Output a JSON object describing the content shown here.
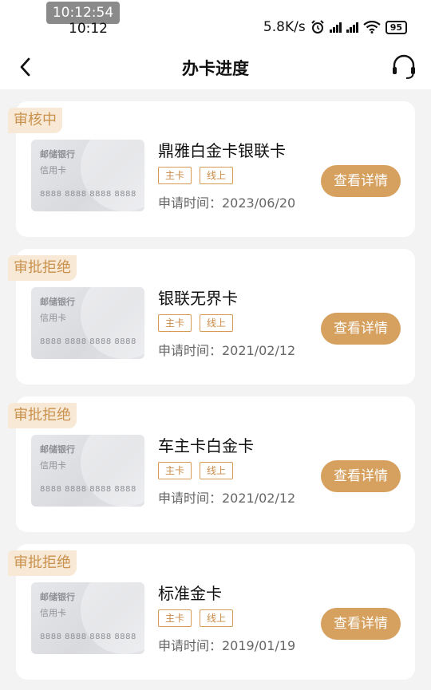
{
  "status_bar": {
    "time_overlay": "10:12:54",
    "time": "10:12",
    "net_speed": "5.8K/s",
    "battery": "95"
  },
  "header": {
    "title": "办卡进度"
  },
  "applications": [
    {
      "status": "审核中",
      "card_image": {
        "bank": "邮储银行",
        "type": "信用卡",
        "number": "8888 8888 8888 8888"
      },
      "name": "鼎雅白金卡银联卡",
      "badges": [
        "主卡",
        "线上"
      ],
      "date": "申请时间：2023/06/20",
      "button": "查看详情"
    },
    {
      "status": "审批拒绝",
      "card_image": {
        "bank": "邮储银行",
        "type": "信用卡",
        "number": "8888 8888 8888 8888"
      },
      "name": "银联无界卡",
      "badges": [
        "主卡",
        "线上"
      ],
      "date": "申请时间：2021/02/12",
      "button": "查看详情"
    },
    {
      "status": "审批拒绝",
      "card_image": {
        "bank": "邮储银行",
        "type": "信用卡",
        "number": "8888 8888 8888 8888"
      },
      "name": "车主卡白金卡",
      "badges": [
        "主卡",
        "线上"
      ],
      "date": "申请时间：2021/02/12",
      "button": "查看详情"
    },
    {
      "status": "审批拒绝",
      "card_image": {
        "bank": "邮储银行",
        "type": "信用卡",
        "number": "8888 8888 8888 8888"
      },
      "name": "标准金卡",
      "badges": [
        "主卡",
        "线上"
      ],
      "date": "申请时间：2019/01/19",
      "button": "查看详情"
    }
  ],
  "colors": {
    "accent": "#d6a05f",
    "status_tag_bg": "#f8e9d6",
    "status_tag_text": "#c9914c",
    "page_bg": "#f3f3f4"
  }
}
